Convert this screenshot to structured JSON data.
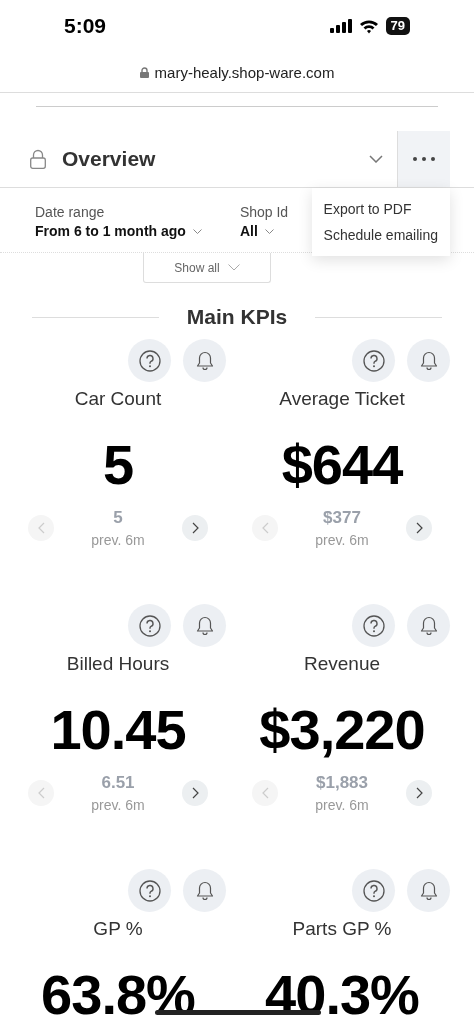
{
  "status_bar": {
    "time": "5:09",
    "battery": "79"
  },
  "browser": {
    "url": "mary-healy.shop-ware.com"
  },
  "header": {
    "title": "Overview"
  },
  "filters": [
    {
      "label": "Date range",
      "value": "From 6 to 1 month ago"
    },
    {
      "label": "Shop Id",
      "value": "All"
    }
  ],
  "menu": {
    "open": true,
    "items": [
      "Export to PDF",
      "Schedule emailing"
    ]
  },
  "show_all": "Show all",
  "section_title": "Main KPIs",
  "kpis": [
    {
      "title": "Car Count",
      "value": "5",
      "previous": "5",
      "period": "prev. 6m",
      "prev_disabled": true,
      "next_disabled": false
    },
    {
      "title": "Average Ticket",
      "value": "$644",
      "previous": "$377",
      "period": "prev. 6m",
      "prev_disabled": true,
      "next_disabled": false
    },
    {
      "title": "Billed Hours",
      "value": "10.45",
      "previous": "6.51",
      "period": "prev. 6m",
      "prev_disabled": true,
      "next_disabled": false
    },
    {
      "title": "Revenue",
      "value": "$3,220",
      "previous": "$1,883",
      "period": "prev. 6m",
      "prev_disabled": true,
      "next_disabled": false
    },
    {
      "title": "GP %",
      "value": "63.8%"
    },
    {
      "title": "Parts GP %",
      "value": "40.3%"
    }
  ]
}
